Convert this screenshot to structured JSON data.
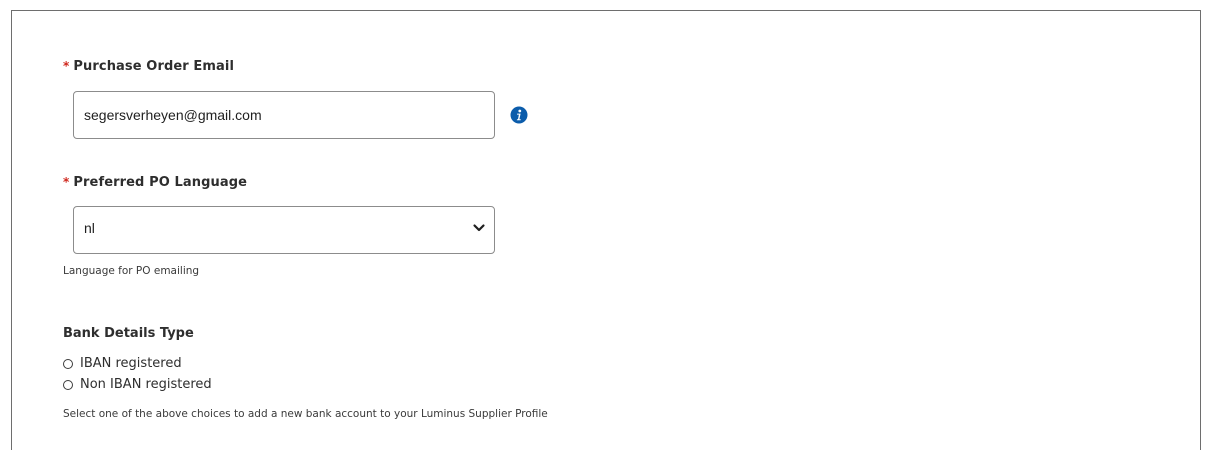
{
  "po_email": {
    "label": "Purchase Order Email",
    "required_marker": "*",
    "value": "segersverheyen@gmail.com",
    "info_icon": "info-icon",
    "info_color": "#0b5cab"
  },
  "po_language": {
    "label": "Preferred PO Language",
    "required_marker": "*",
    "selected": "nl",
    "help": "Language for PO emailing"
  },
  "bank_details": {
    "title": "Bank Details Type",
    "options": [
      {
        "label": "IBAN registered",
        "selected": false
      },
      {
        "label": "Non IBAN registered",
        "selected": false
      }
    ],
    "help": "Select one of the above choices to add a new bank account to your Luminus Supplier Profile"
  },
  "colors": {
    "required": "#d0271d",
    "border": "#8c8c8c",
    "text": "#2e2e2e"
  }
}
